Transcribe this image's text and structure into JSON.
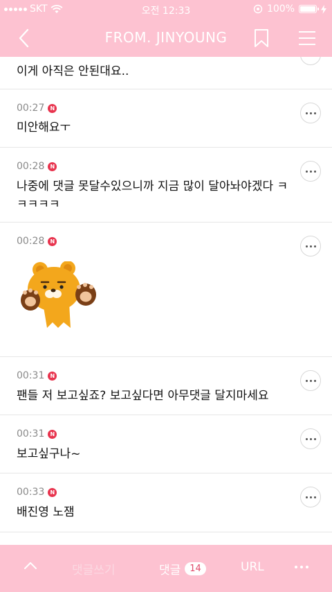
{
  "status_bar": {
    "carrier": "SKT",
    "time": "오전 12:33",
    "battery": "100%"
  },
  "header": {
    "title": "FROM. JINYOUNG"
  },
  "messages": [
    {
      "time": "",
      "badge": "",
      "text": "이게 아직은 안된대요.."
    },
    {
      "time": "00:27",
      "badge": "N",
      "text": "미안해요ㅜ"
    },
    {
      "time": "00:28",
      "badge": "N",
      "text": "나중에 댓글 못달수있으니까 지금 많이 달아놔야겠다 ㅋㅋㅋㅋㅋ"
    },
    {
      "time": "00:28",
      "badge": "N",
      "text": ""
    },
    {
      "time": "00:31",
      "badge": "N",
      "text": "팬들 저 보고싶죠? 보고싶다면 아무댓글 달지마세요"
    },
    {
      "time": "00:31",
      "badge": "N",
      "text": "보고싶구나~"
    },
    {
      "time": "00:33",
      "badge": "N",
      "text": "배진영 노잼"
    }
  ],
  "sticker": {
    "icon": "lion-bear-character-sticker"
  },
  "bottom_bar": {
    "write_label": "댓글쓰기",
    "comments_label": "댓글",
    "comments_count": "14",
    "url_label": "URL"
  }
}
